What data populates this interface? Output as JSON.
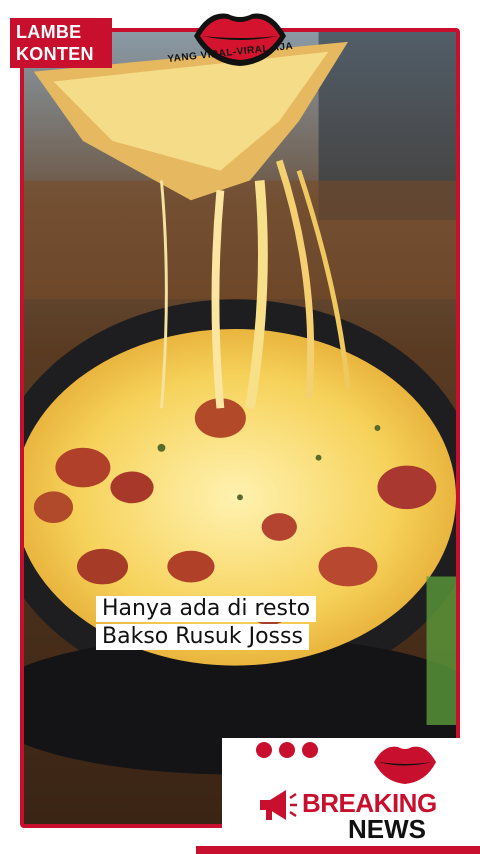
{
  "brand": {
    "line1": "LAMBE",
    "line2": "KONTEN"
  },
  "tagline": "YANG VIRAL-VIRAL AJA",
  "caption": {
    "line1": "Hanya ada di resto",
    "line2": "Bakso Rusuk Josss"
  },
  "badge": {
    "breaking": "BREAKING",
    "news": "NEWS"
  },
  "colors": {
    "accent": "#c8102e",
    "cheese": "#f2c94c",
    "pan": "#1e1e20"
  },
  "icons": [
    "lips-icon",
    "megaphone-icon"
  ]
}
